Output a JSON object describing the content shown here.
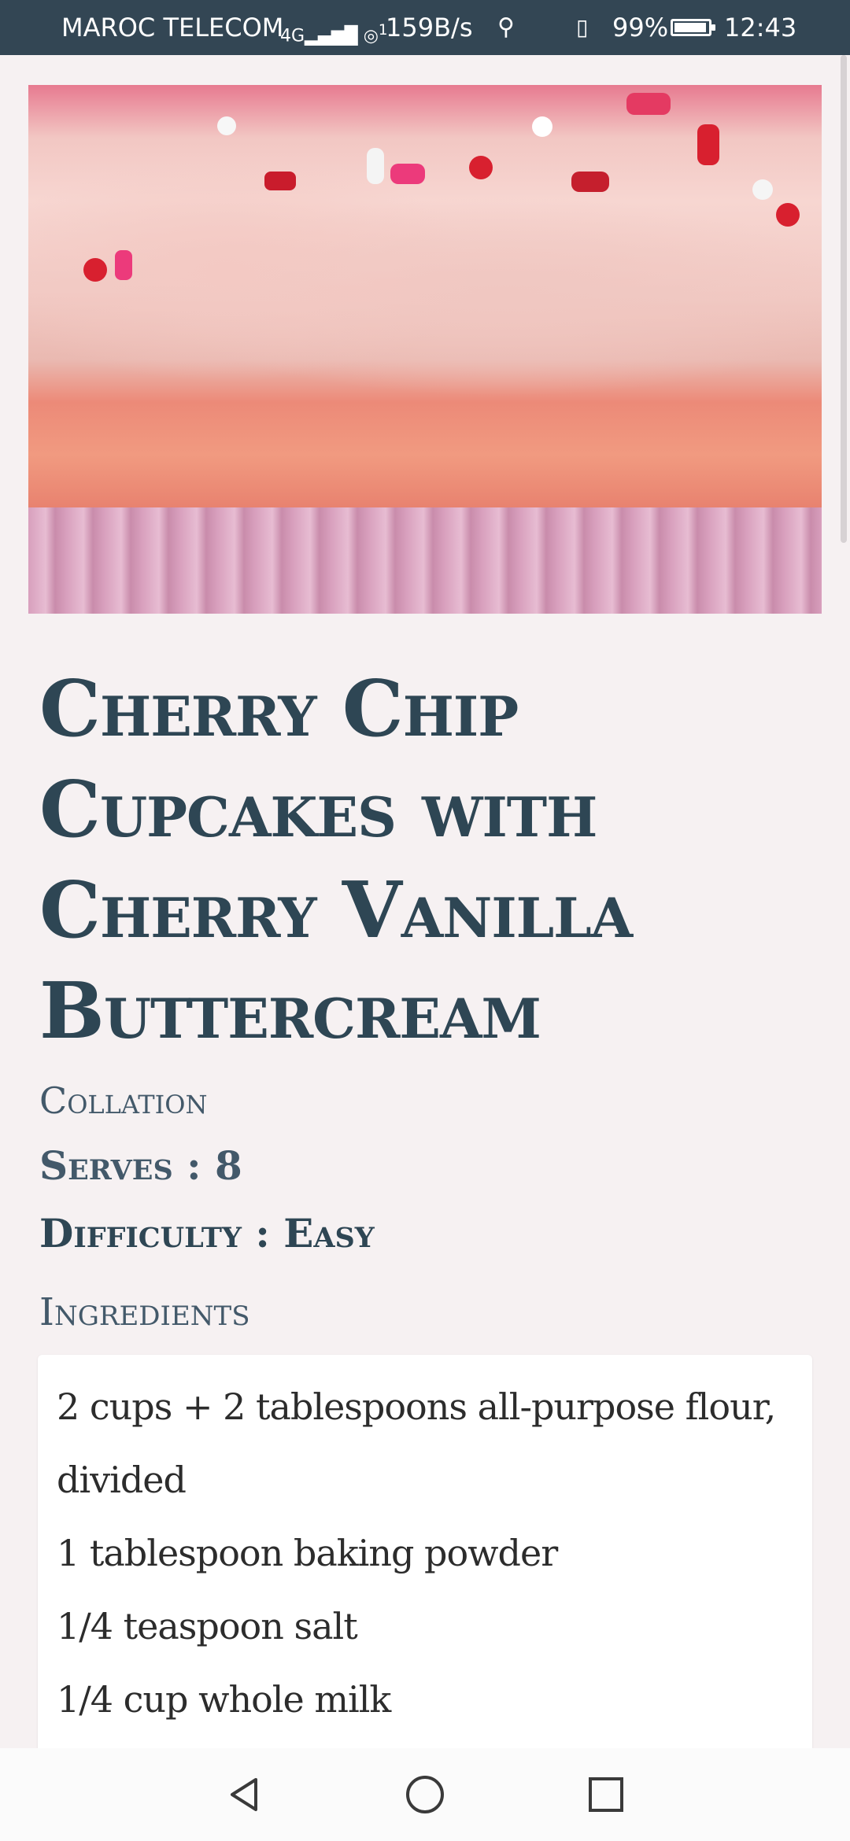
{
  "status_bar": {
    "carrier": "MAROC TELECOM",
    "network_label": "4G",
    "hotspot_label": "1",
    "net_speed": "159B/s",
    "battery": "99%",
    "time": "12:43",
    "icons": [
      "signal-icon",
      "hotspot-icon",
      "usb-icon",
      "vibrate-icon",
      "battery-icon"
    ]
  },
  "recipe": {
    "image_alt_icon": "cupcake-photo",
    "title": "Cherry Chip Cupcakes with Cherry Vanilla Buttercream",
    "category": "Collation",
    "serves": "Serves : 8",
    "difficulty": "Difficulty : Easy",
    "ingredients_heading": "Ingredients",
    "ingredients": [
      "2 cups + 2 tablespoons all-purpose flour, divided",
      "1 tablespoon baking powder",
      "1/4 teaspoon salt",
      "1/4 cup whole milk"
    ]
  },
  "nav_bar": {
    "icons": [
      "back-icon",
      "home-icon",
      "recents-icon"
    ]
  },
  "colors": {
    "status_bar_bg": "#334654",
    "page_bg": "#f6f1f2",
    "title_color": "#2e4654"
  }
}
